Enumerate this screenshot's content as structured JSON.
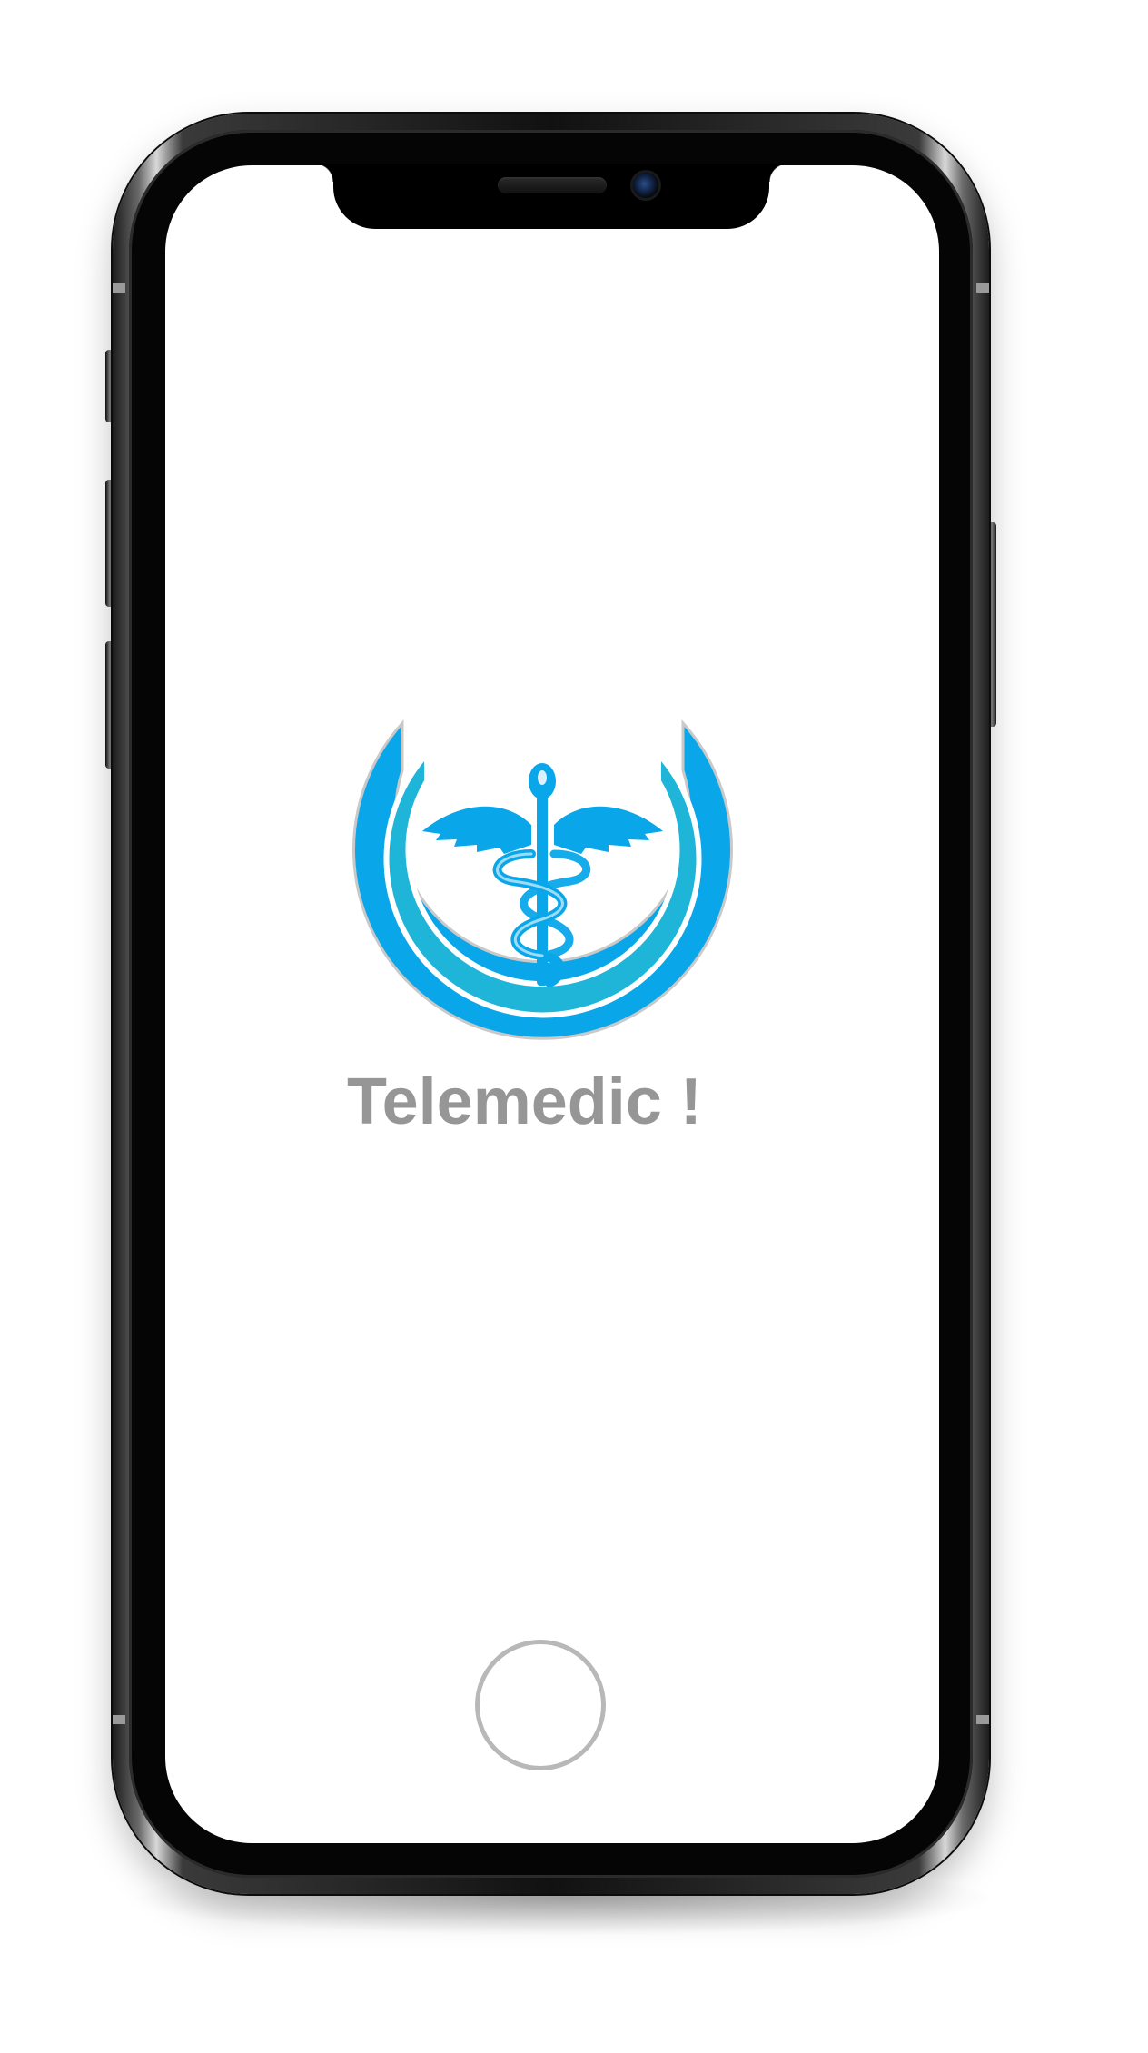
{
  "app": {
    "name": "Telemedic !"
  },
  "logo": {
    "icon": "caduceus-icon",
    "ring_colors": [
      "#0aa6ea",
      "#1fb5d8"
    ]
  },
  "device": {
    "model": "smartphone-mockup",
    "home_button_icon": "home-button-circle"
  },
  "colors": {
    "brand_blue": "#0aa6ea",
    "text_gray": "#969696",
    "screen_bg": "#ffffff"
  }
}
